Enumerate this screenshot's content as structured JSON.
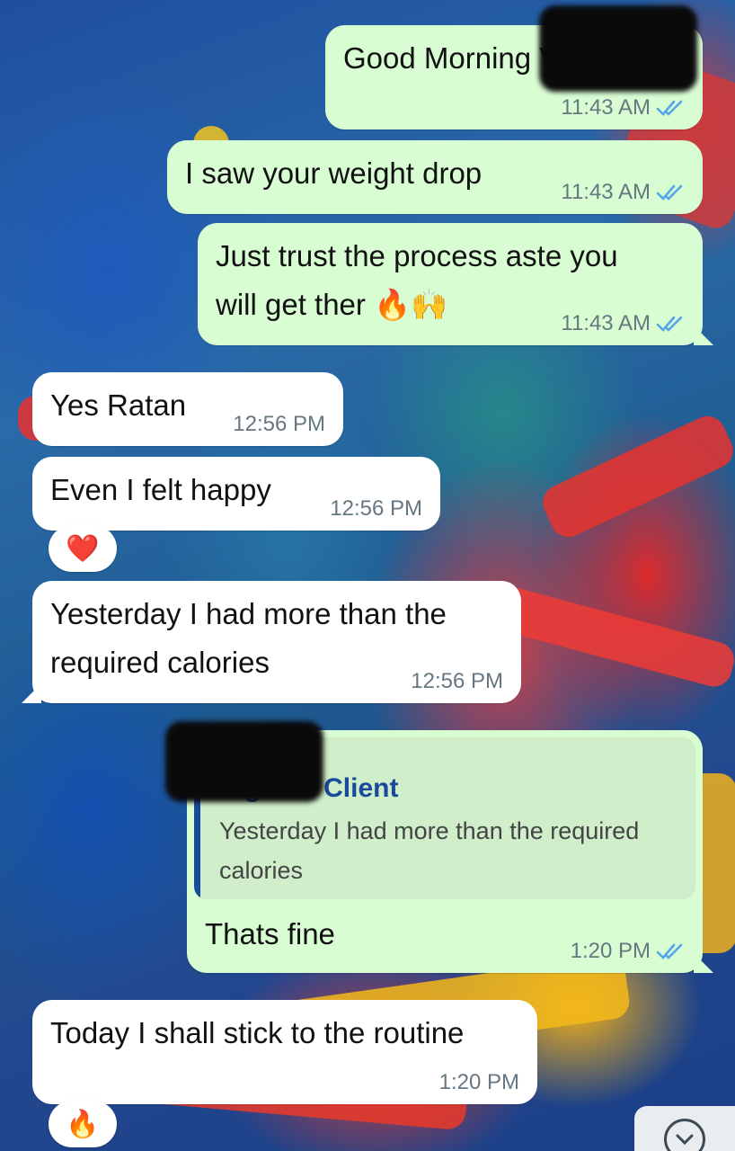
{
  "messages": [
    {
      "id": "m1",
      "direction": "outgoing",
      "text": "Good Morning V",
      "time": "11:43 AM",
      "status": "read"
    },
    {
      "id": "m2",
      "direction": "outgoing",
      "text": "I saw your weight drop",
      "time": "11:43 AM",
      "status": "read"
    },
    {
      "id": "m3",
      "direction": "outgoing",
      "text": "Just trust the process aste you\nwill get ther 🔥🙌",
      "time": "11:43 AM",
      "status": "read"
    },
    {
      "id": "m4",
      "direction": "incoming",
      "text": "Yes Ratan",
      "time": "12:56 PM"
    },
    {
      "id": "m5",
      "direction": "incoming",
      "text": "Even I felt happy",
      "time": "12:56 PM",
      "reaction": "❤️"
    },
    {
      "id": "m6",
      "direction": "incoming",
      "text": "Yesterday I had more than the\nrequired calories",
      "time": "12:56 PM"
    },
    {
      "id": "m7",
      "direction": "outgoing",
      "text": "Thats fine",
      "time": "1:20 PM",
      "status": "read",
      "quoted": {
        "author": "Vig  sh - Client",
        "text": "Yesterday I had more than the required calories"
      }
    },
    {
      "id": "m8",
      "direction": "incoming",
      "text": "Today I shall stick to the routine",
      "time": "1:20 PM",
      "reaction": "🔥"
    }
  ],
  "colors": {
    "outgoing_bubble": "#d9fdd3",
    "incoming_bubble": "#ffffff",
    "read_ticks": "#53a6e8",
    "quote_author": "#1a4a9c",
    "timestamp": "#667781"
  },
  "icons": {
    "read_receipt": "double-check-icon",
    "scroll_down": "chevron-down-icon"
  }
}
